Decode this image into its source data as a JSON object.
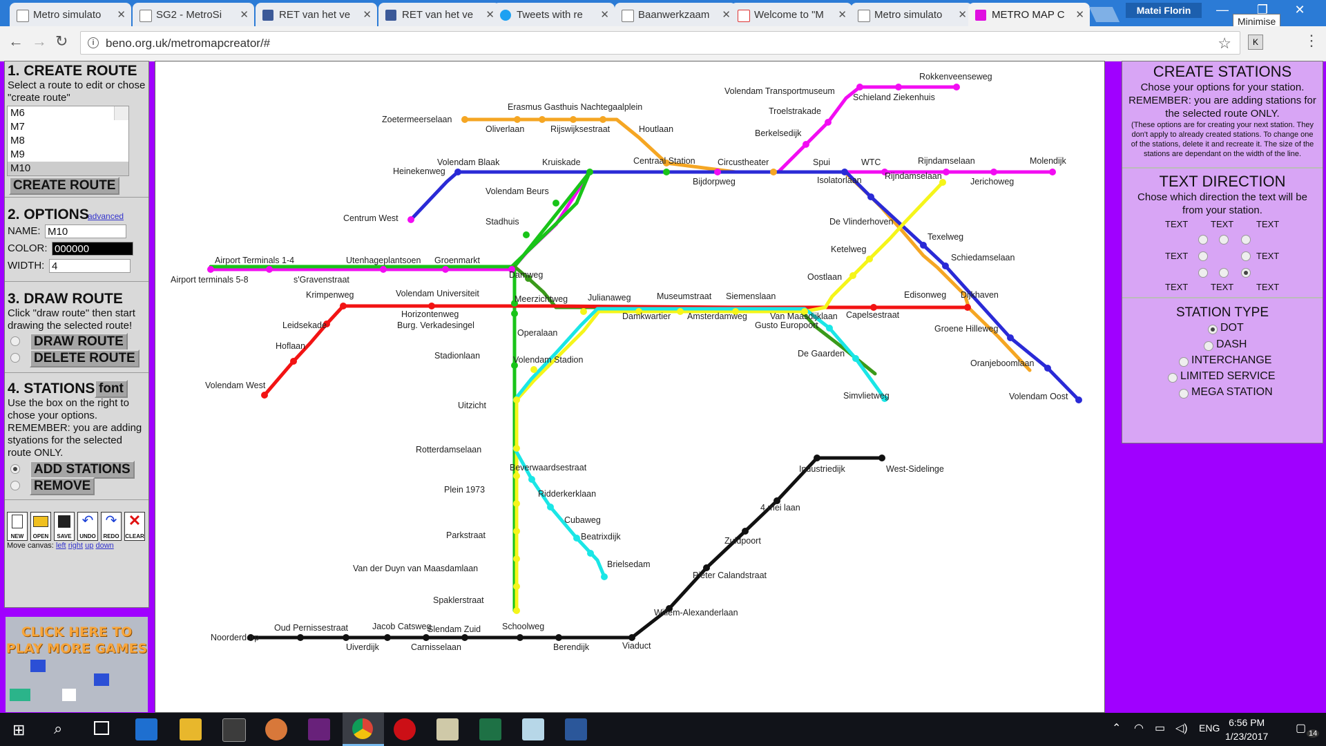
{
  "browser": {
    "tabs": [
      {
        "label": "Metro simulato",
        "icon": "doc-icon"
      },
      {
        "label": "SG2 - MetroSi",
        "icon": "doc-icon"
      },
      {
        "label": "RET van het ve",
        "icon": "facebook-icon"
      },
      {
        "label": "RET van het ve",
        "icon": "facebook-icon"
      },
      {
        "label": "Tweets with re",
        "icon": "twitter-icon"
      },
      {
        "label": "Baanwerkzaam",
        "icon": "doc-icon"
      },
      {
        "label": "Welcome to \"M",
        "icon": "gmail-icon"
      },
      {
        "label": "Metro simulato",
        "icon": "doc-icon"
      },
      {
        "label": "METRO MAP C",
        "icon": "metro-icon"
      }
    ],
    "user": "Matei Florin",
    "tooltip": "Minimise",
    "url": "beno.org.uk/metromapcreator/#"
  },
  "left": {
    "create": {
      "title": "1. CREATE ROUTE",
      "desc": "Select a route to edit or chose \"create route\"",
      "routes": [
        "M6",
        "M7",
        "M8",
        "M9",
        "M10"
      ],
      "selected": "M10",
      "button": "CREATE ROUTE"
    },
    "options": {
      "title": "2. OPTIONS",
      "advanced": "advanced",
      "name_label": "NAME:",
      "name_value": "M10",
      "color_label": "COLOR:",
      "color_value": "000000",
      "width_label": "WIDTH:",
      "width_value": "4"
    },
    "draw": {
      "title": "3. DRAW ROUTE",
      "desc": "Click \"draw route\" then start drawing the selected route!",
      "draw_btn": "DRAW ROUTE",
      "delete_btn": "DELETE ROUTE"
    },
    "stations": {
      "title": "4. STATIONS",
      "font_btn": "font",
      "desc": "Use the box on the right to chose your options. REMEMBER: you are adding styations for the selected route ONLY.",
      "add_btn": "ADD STATIONS",
      "remove_btn": "REMOVE"
    },
    "tools": [
      "NEW",
      "OPEN",
      "SAVE",
      "UNDO",
      "REDO",
      "CLEAR"
    ],
    "move": {
      "label": "Move canvas:",
      "left": "left",
      "right": "right",
      "up": "up",
      "down": "down"
    },
    "ad": "CLICK HERE TO PLAY MORE GAMES"
  },
  "right": {
    "create": {
      "title": "CREATE STATIONS",
      "desc": "Chose your options for your station. REMEMBER: you are adding stations for the selected route ONLY.",
      "note": "(These options are for creating your next station. They don't apply to already created stations. To change one of the stations, delete it and recreate it. The size of the stations are dependant on the width of the line."
    },
    "text_direction": {
      "title": "TEXT DIRECTION",
      "desc": "Chose which direction the text will be from your station.",
      "label": "TEXT"
    },
    "station_type": {
      "title": "STATION TYPE",
      "options": [
        "DOT",
        "DASH",
        "INTERCHANGE",
        "LIMITED SERVICE",
        "MEGA STATION"
      ],
      "selected": "DOT"
    }
  },
  "map": {
    "lines": {
      "orange": "#f5a623",
      "magenta": "#f20cf2",
      "blue": "#2a2ad6",
      "green": "#19c419",
      "olive": "#3a9a1a",
      "red": "#f21313",
      "yellow": "#f5f51a",
      "cyan": "#1ae6e6",
      "black": "#111111"
    },
    "stations": [
      "Rokkenveenseweg",
      "Volendam Transportmuseum",
      "Schieland Ziekenhuis",
      "Troelstrakade",
      "Berkelsedijk",
      "Erasmus Gasthuis Nachtegaalplein",
      "Zoetermeerselaan",
      "Oliverlaan",
      "Rijswijksestraat",
      "Houtlaan",
      "Volendam Blaak",
      "Kruiskade",
      "Centraal Station",
      "Circustheater",
      "Spui",
      "WTC",
      "Rijndamselaan",
      "Molendijk",
      "Heinekenweg",
      "Bijdorpweg",
      "Isolatorlaan",
      "Rijndamselaan",
      "Jerichoweg",
      "Volendam Beurs",
      "Centrum West",
      "Stadhuis",
      "De Vlinderhoven",
      "Texelweg",
      "Ketelweg",
      "Schiedamselaan",
      "Airport Terminals 1-4",
      "Utenhageplantsoen",
      "Groenmarkt",
      "Airport terminals 5-8",
      "s'Gravenstraat",
      "Damweg",
      "Oostlaan",
      "Krimpenweg",
      "Volendam Universiteit",
      "Meerzichtweg",
      "Julianaweg",
      "Museumstraat",
      "Siemenslaan",
      "Edisonweg",
      "Dijkhaven",
      "Leidsekade",
      "Horizontenweg",
      "Burg. Verkadesingel",
      "Operalaan",
      "Damkwartier",
      "Amsterdamweg",
      "Van Maasdijklaan",
      "Capelsestraat",
      "Gusto Europoort",
      "Hoflaan",
      "Groene Hilleweg",
      "Stadionlaan",
      "Volendam Stadion",
      "De Gaarden",
      "Oranjeboomlaan",
      "Volendam West",
      "Simvlietweg",
      "Volendam Oost",
      "Uitzicht",
      "Industriedijk",
      "West-Sidelinge",
      "Rotterdamselaan",
      "Beverwaardsestraat",
      "4 mei laan",
      "Plein 1973",
      "Ridderkerklaan",
      "Cubaweg",
      "Parkstraat",
      "Zuidpoort",
      "Beatrixdijk",
      "Brielsedam",
      "Van der Duyn van Maasdamlaan",
      "Pieter Calandstraat",
      "Spaklerstraat",
      "Willem-Alexanderlaan",
      "Oud Pernissestraat",
      "Jacob Catsweg",
      "Slendam Zuid",
      "Schoolweg",
      "Noorderdorp",
      "Uiverdijk",
      "Carnisselaan",
      "Berendijk",
      "Viaduct"
    ]
  },
  "taskbar": {
    "lang": "ENG",
    "time": "6:56 PM",
    "date": "1/23/2017",
    "notif": "14"
  }
}
